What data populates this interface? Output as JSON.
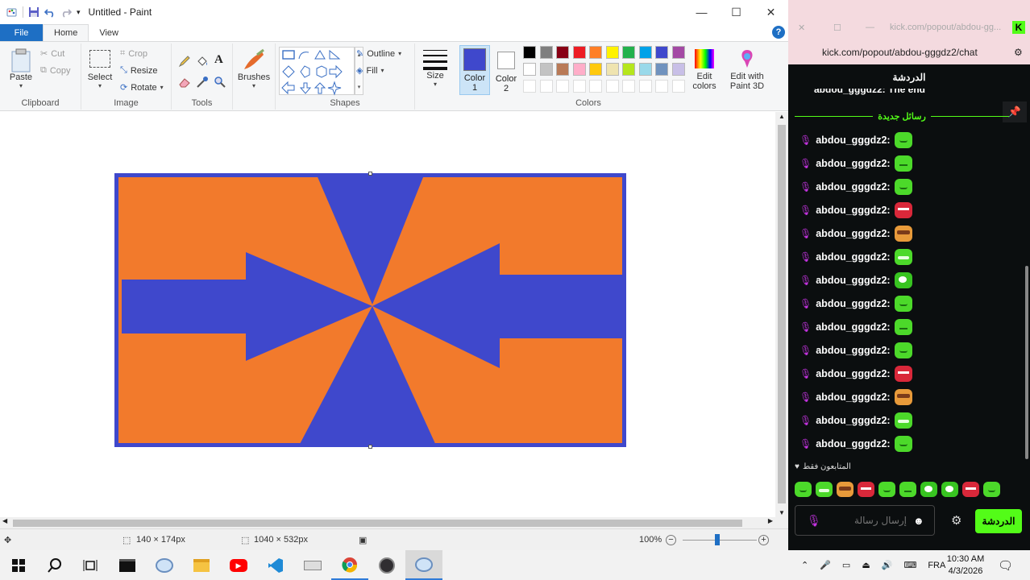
{
  "paint": {
    "title": "Untitled - Paint",
    "tabs": {
      "file": "File",
      "home": "Home",
      "view": "View"
    },
    "clipboard": {
      "paste": "Paste",
      "cut": "Cut",
      "copy": "Copy",
      "label": "Clipboard"
    },
    "image": {
      "select": "Select",
      "crop": "Crop",
      "resize": "Resize",
      "rotate": "Rotate",
      "label": "Image"
    },
    "tools": {
      "label": "Tools"
    },
    "brushes": "Brushes",
    "shapes": {
      "outline": "Outline",
      "fill": "Fill",
      "label": "Shapes"
    },
    "size": "Size",
    "color1": {
      "line1": "Color",
      "line2": "1"
    },
    "color2": {
      "line1": "Color",
      "line2": "2"
    },
    "colors_label": "Colors",
    "edit_colors": {
      "line1": "Edit",
      "line2": "colors"
    },
    "paint3d": {
      "line1": "Edit with",
      "line2": "Paint 3D"
    },
    "palette_row1": [
      "#000000",
      "#7f7f7f",
      "#880015",
      "#ed1c24",
      "#ff7f27",
      "#fff200",
      "#22b14c",
      "#00a2e8",
      "#3f48cc",
      "#a349a4"
    ],
    "palette_row2": [
      "#ffffff",
      "#c3c3c3",
      "#b97a57",
      "#ffaec9",
      "#ffc90e",
      "#efe4b0",
      "#b5e61d",
      "#99d9ea",
      "#7092be",
      "#c8bfe7"
    ],
    "active_color1": "#3f48cc",
    "active_color2": "#ffffff",
    "status": {
      "cursor": "140 × 174px",
      "canvas": "1040 × 532px",
      "zoom": "100%"
    },
    "drawing_colors": {
      "background": "#f27a2c",
      "shape": "#3f48cc"
    }
  },
  "chat": {
    "window_url_short": "kick.com/popout/abdou-gg...",
    "url": "kick.com/popout/abdou-gggdz2/chat",
    "header": "الدردشة",
    "new_messages": "رسائل جديدة",
    "partial_message": "abdou_gggdz2: The end",
    "messages": [
      {
        "user": "abdou_gggdz2:",
        "emote": "green-smile"
      },
      {
        "user": "abdou_gggdz2:",
        "emote": "green-sad"
      },
      {
        "user": "abdou_gggdz2:",
        "emote": "green-smile"
      },
      {
        "user": "abdou_gggdz2:",
        "emote": "red-angry"
      },
      {
        "user": "abdou_gggdz2:",
        "emote": "burger-face"
      },
      {
        "user": "abdou_gggdz2:",
        "emote": "green-grin"
      },
      {
        "user": "abdou_gggdz2:",
        "emote": "green-eyes"
      },
      {
        "user": "abdou_gggdz2:",
        "emote": "green-smile"
      },
      {
        "user": "abdou_gggdz2:",
        "emote": "green-sad"
      },
      {
        "user": "abdou_gggdz2:",
        "emote": "green-smile"
      },
      {
        "user": "abdou_gggdz2:",
        "emote": "red-angry"
      },
      {
        "user": "abdou_gggdz2:",
        "emote": "burger-face"
      },
      {
        "user": "abdou_gggdz2:",
        "emote": "green-grin"
      },
      {
        "user": "abdou_gggdz2:",
        "emote": "green-smile"
      }
    ],
    "followers_only": "المتابعون فقط",
    "input_placeholder": "إرسال رسالة",
    "send": "الدردشة",
    "accent": "#53fc18"
  },
  "taskbar": {
    "lang": "FRA",
    "time": "10:30 AM",
    "date": "4/3/2026"
  }
}
